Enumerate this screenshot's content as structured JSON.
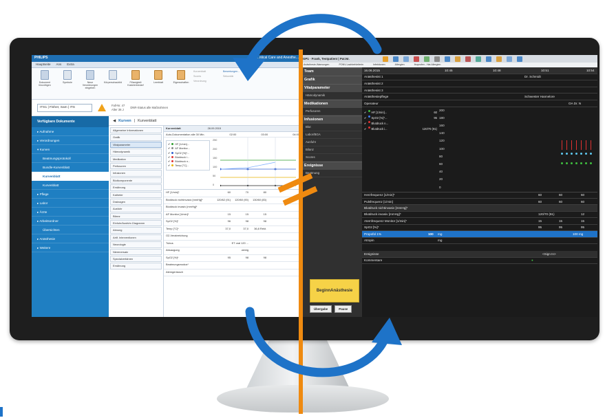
{
  "left_app": {
    "brand": "PHILIPS",
    "title": "...ntical Care and Anesthe...",
    "ribbon_tabs": [
      "Hauptseite",
      "Ans",
      "Extra"
    ],
    "ribbon_buttons": [
      "Dokument hinzufügen",
      "Symbole",
      "Neue Verordnungen eingeben",
      "Körperschaubild",
      "Flüssigkeit Kalorienbedarf",
      "Leerblatt",
      "Eigenschaften"
    ],
    "ribbon_small": [
      "Kurvenblatt",
      "Bewertungen...",
      "Scores",
      "Verordnung",
      "Sekundär"
    ],
    "patient": {
      "selector": "ITS1 | Fisher, Sam | ITS",
      "fall_label": "Fall-Nr.",
      "fall_value": "47",
      "alter_label": "Alter",
      "alter_value": "36 J",
      "status": "DNR-Status   alle Maßnahmen"
    },
    "nav": {
      "header": "Verfügbare Dokumente",
      "items": [
        "▸ Aufnahme",
        "▸ Verordnungen",
        "▾ Kurven",
        "Beatmungsprotokoll",
        "Bundle-Kurvenblatt",
        "Kurvenblatt",
        "Kurvenblatt",
        "▸ Pflege",
        "▸ Labor",
        "▸ Ärzte",
        "▸ Arbeitsordner",
        "Übersichten",
        "▸ Anästhesie",
        "▸ Weitere"
      ]
    },
    "content_title_prefix": "Kurven",
    "content_title": "Kurvenblatt",
    "categories": [
      "Allgemeine Informationen",
      "Grafik",
      "Vitalparameter",
      "Hämodynamik",
      "Medikation",
      "Perfusoren",
      "Infusionen",
      "Blutkomponente",
      "Ernährung",
      "Katheter",
      "Drainagen",
      "Ausfuhr",
      "Bilanz",
      "Einfuhr/Ausfuhr-Diagramm",
      "Atmung",
      "Artif. Interventionen",
      "Neurologie",
      "Nierenersatz",
      "Spezialverfahren",
      "Ernährung"
    ],
    "grid_header": [
      "Kurvenblatt",
      "28.09.2015"
    ],
    "grid_sub": [
      "Auto-Dokumentation alle 30 Min.",
      "02:00",
      "03:00",
      "04:00"
    ],
    "legend": [
      "HF [1/min]...",
      "AF Monitor...",
      "SpO2 [%]*...",
      "Blutdruck i...",
      "Blutdruck n...",
      "Temp [°C]..."
    ],
    "yticks": [
      "250",
      "200",
      "150",
      "100",
      "50",
      "0"
    ],
    "rows": [
      {
        "label": "HF [1/min]*",
        "v1": "60",
        "v2": "70",
        "v3": "80"
      },
      {
        "label": "Blutdruck nichtinvasiv [mmHg]*",
        "v1": "120/62 (91)",
        "v2": "120/60 (90)",
        "v3": "130/60 (83)"
      },
      {
        "label": "Blutdruck invasiv [mmHg]*",
        "v1": "",
        "v2": "",
        "v3": ""
      },
      {
        "label": "AF Monitor [1/min]*",
        "v1": "15",
        "v2": "15",
        "v3": "15"
      },
      {
        "label": "SpO2 [%]*",
        "v1": "96",
        "v2": "98",
        "v3": "98"
      },
      {
        "label": "Temp [°C]*",
        "v1": "37,0",
        "v2": "37,0",
        "v3": "36,8 Rekt."
      },
      {
        "label": "O2-Verabreichung",
        "v1": "",
        "v2": "",
        "v3": ""
      },
      {
        "label": "Tubus",
        "v1": "",
        "v2": "ET oral 120 ...",
        "v3": ""
      },
      {
        "label": "Absaugung",
        "v1": "",
        "v2": "wenig",
        "v3": ""
      },
      {
        "label": "SpO2 [%]*",
        "v1": "95",
        "v2": "98",
        "v3": "98"
      },
      {
        "label": "Beatmungsmodus*",
        "v1": "",
        "v2": "",
        "v3": ""
      },
      {
        "label": "Atemgeräusch",
        "v1": "",
        "v2": "",
        "v3": ""
      }
    ]
  },
  "right_app": {
    "patient": "GP1 · Frank, Testpatient | Pat.Nr.",
    "subbar": [
      "Anästhesie-Warnungen",
      "PONV-Lachbehleiterin",
      "Infektionen",
      "Allergien",
      "Ibuprofen - Hat Allergien"
    ],
    "date": "16.06.2015",
    "times": [
      "10:45",
      "10:48",
      "10:51",
      "10:54"
    ],
    "sections": [
      {
        "title": "Team",
        "items": []
      },
      {
        "title": "Grafik",
        "items": []
      },
      {
        "title": "Vitalparameter",
        "items": [
          "Hämodynamik"
        ]
      },
      {
        "title": "Medikationen",
        "items": [
          "Perfusoren"
        ]
      },
      {
        "title": "Infusionen",
        "items": [
          "Blut",
          "Labor/BGA",
          "Ausfuhr",
          "Bilanz",
          "Scores"
        ]
      },
      {
        "title": "Ereignisse",
        "items": [
          "Beatmung"
        ]
      }
    ],
    "begin_line1": "Beginn",
    "begin_line2": "Anästhesie",
    "btn_left": "Übergabe",
    "btn_right": "Pause",
    "team": [
      {
        "label": "Anästhesist 1",
        "value": "Dr. Schmidt"
      },
      {
        "label": "Anästhesist 2",
        "value": ""
      },
      {
        "label": "Anästhesist 3",
        "value": ""
      },
      {
        "label": "Anästhesiepflege",
        "value": "Schwester Hannelore"
      },
      {
        "label": "Operateur",
        "value": "OA Dr. N"
      }
    ],
    "legend": [
      {
        "label": "HF [1/min]...",
        "value": "60",
        "color": "#3fbf3f"
      },
      {
        "label": "SpO2 [%]*...",
        "value": "95",
        "color": "#3f7fff"
      },
      {
        "label": "Blutdruck n...",
        "value": "",
        "color": "#e03131"
      },
      {
        "label": "Blutdruck i...",
        "value": "120/70 (91)",
        "color": "#e03131"
      }
    ],
    "yticks": [
      "200",
      "180",
      "160",
      "140",
      "120",
      "100",
      "80",
      "60",
      "40",
      "20",
      "0"
    ],
    "vitals": [
      {
        "label": "Herzfrequenz [1/min]*",
        "a": "60",
        "b": "60",
        "c": "60"
      },
      {
        "label": "Pulsfrequenz [1/min]",
        "a": "60",
        "b": "60",
        "c": "60"
      },
      {
        "label": "Blutdruck nichtinvasiv [mmHg]*",
        "a": "",
        "b": "",
        "c": ""
      },
      {
        "label": "Blutdruck invasiv [mmHg]*",
        "a": "120/70 (91)",
        "b": "",
        "c": "12"
      },
      {
        "label": "Atemfrequenz Monitor [1/min]*",
        "a": "15",
        "b": "15",
        "c": "15"
      },
      {
        "label": "SpO2 [%]*",
        "a": "95",
        "b": "95",
        "c": "95"
      }
    ],
    "propofol": {
      "label": "Propofol 1%",
      "dose": "100",
      "unit": "mg",
      "right": "100 mg"
    },
    "atropin": {
      "label": "Atropin",
      "unit": "mg"
    },
    "events": [
      {
        "label": "Ereignisse",
        "value": "<Sign In>"
      },
      {
        "label": "Kommentare",
        "value": ""
      }
    ]
  },
  "colors": {
    "accent_orange": "#ef8a10",
    "cycle_blue": "#1e73c8",
    "begin_yellow": "#f6d247"
  }
}
